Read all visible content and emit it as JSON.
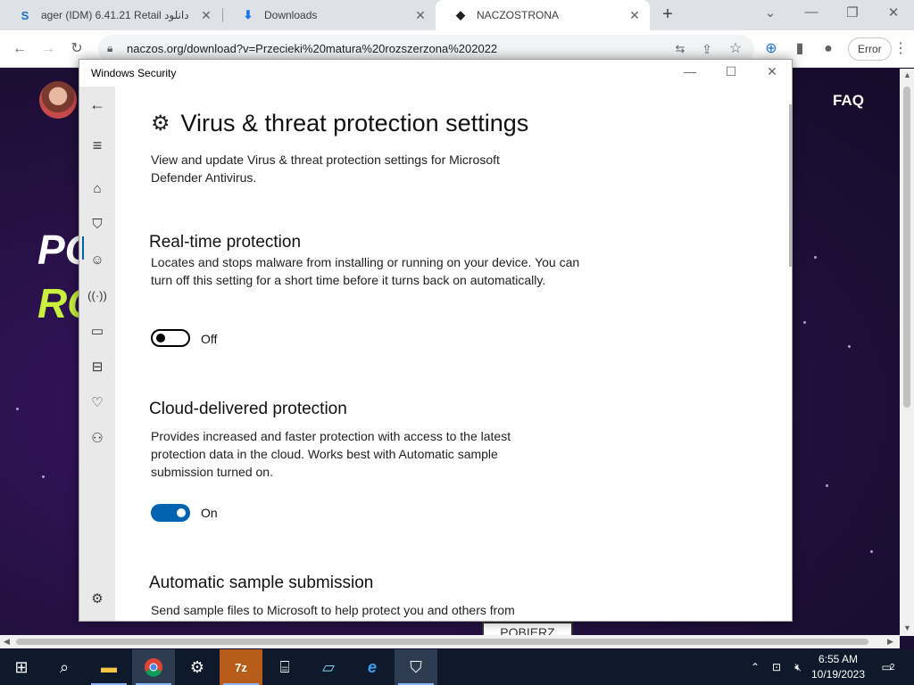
{
  "browser": {
    "tabs": [
      {
        "title": "ager (IDM) 6.41.21 Retail دانلود",
        "favicon": "s-logo-icon",
        "active": false
      },
      {
        "title": "Downloads",
        "favicon": "download-icon",
        "active": false
      },
      {
        "title": "NACZOSTRONA",
        "favicon": "site-icon",
        "active": true
      }
    ],
    "new_tab": "+",
    "url": "naczos.org/download?v=Przecieki%20matura%20rozszerzona%202022",
    "profile_button": "Error"
  },
  "webpage": {
    "nav_link": "FAQ",
    "hero_line1": "PO",
    "hero_line2": "RO",
    "download_button": "POBIERZ"
  },
  "window": {
    "title": "Windows Security",
    "page_title": "Virus & threat protection settings",
    "page_description": "View and update Virus & threat protection settings for Microsoft Defender Antivirus.",
    "sections": [
      {
        "heading": "Real-time protection",
        "description": "Locates and stops malware from installing or running on your device. You can turn off this setting for a short time before it turns back on automatically.",
        "toggle_state": "Off",
        "on": false
      },
      {
        "heading": "Cloud-delivered protection",
        "description": "Provides increased and faster protection with access to the latest protection data in the cloud. Works best with Automatic sample submission turned on.",
        "toggle_state": "On",
        "on": true
      },
      {
        "heading": "Automatic sample submission",
        "description": "Send sample files to Microsoft to help protect you and others from"
      }
    ]
  },
  "taskbar": {
    "time": "6:55 AM",
    "date": "10/19/2023",
    "notifications": "2"
  },
  "colors": {
    "accent": "#0063b1",
    "taskbar": "#0e1a2b",
    "page_bg": "#22103e",
    "hero_green": "#c8f03c"
  }
}
